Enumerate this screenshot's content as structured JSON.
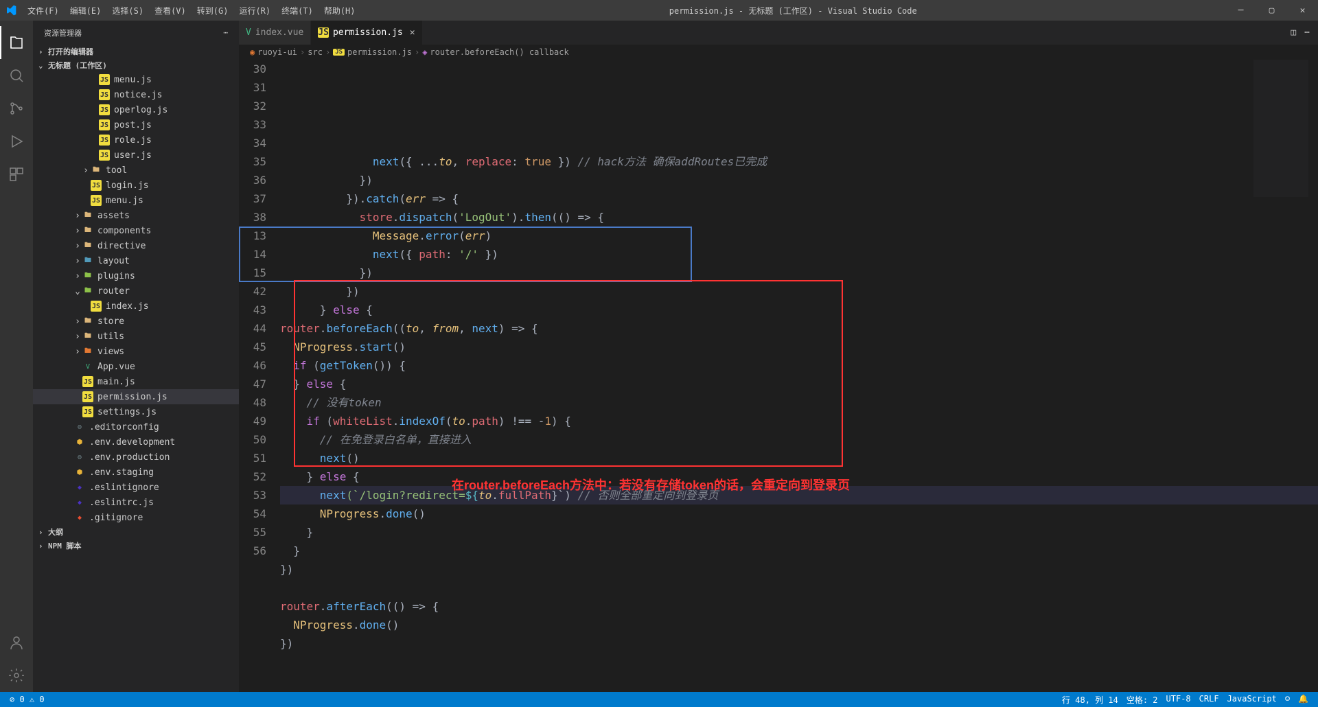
{
  "window": {
    "title": "permission.js - 无标题 (工作区) - Visual Studio Code"
  },
  "menu": {
    "file": "文件(F)",
    "edit": "编辑(E)",
    "select": "选择(S)",
    "view": "查看(V)",
    "goto": "转到(G)",
    "run": "运行(R)",
    "terminal": "终端(T)",
    "help": "帮助(H)"
  },
  "sidebar": {
    "title": "资源管理器",
    "sections": {
      "openEditors": "打开的编辑器",
      "workspace": "无标题 (工作区)",
      "outline": "大纲",
      "npm": "NPM 脚本"
    },
    "tree": {
      "menu_js": "menu.js",
      "notice_js": "notice.js",
      "operlog_js": "operlog.js",
      "post_js": "post.js",
      "role_js": "role.js",
      "user_js": "user.js",
      "tool": "tool",
      "login_js": "login.js",
      "menu_js2": "menu.js",
      "assets": "assets",
      "components": "components",
      "directive": "directive",
      "layout": "layout",
      "plugins": "plugins",
      "router": "router",
      "index_js": "index.js",
      "store": "store",
      "utils": "utils",
      "views": "views",
      "app_vue": "App.vue",
      "main_js": "main.js",
      "permission_js": "permission.js",
      "settings_js": "settings.js",
      "editorconfig": ".editorconfig",
      "env_dev": ".env.development",
      "env_prod": ".env.production",
      "env_staging": ".env.staging",
      "eslintignore": ".eslintignore",
      "eslintrc": ".eslintrc.js",
      "gitignore": ".gitignore"
    }
  },
  "tabs": {
    "index_vue": "index.vue",
    "permission_js": "permission.js"
  },
  "breadcrumbs": {
    "p1": "ruoyi-ui",
    "p2": "src",
    "p3": "permission.js",
    "p4": "router.beforeEach() callback"
  },
  "code": {
    "lines": [
      {
        "n": "30",
        "t": [
          "              ",
          "next",
          "({ ...",
          "to",
          ", ",
          "replace",
          ": ",
          "true",
          " }) ",
          "// hack方法 确保addRoutes已完成"
        ]
      },
      {
        "n": "31",
        "t": [
          "            })"
        ]
      },
      {
        "n": "32",
        "t": [
          "          }).",
          "catch",
          "(",
          "err",
          " => {"
        ]
      },
      {
        "n": "33",
        "t": [
          "            ",
          "store",
          ".",
          "dispatch",
          "(",
          "'LogOut'",
          ").",
          "then",
          "(() => {"
        ]
      },
      {
        "n": "34",
        "t": [
          "              ",
          "Message",
          ".",
          "error",
          "(",
          "err",
          ")"
        ]
      },
      {
        "n": "35",
        "t": [
          "              ",
          "next",
          "({ ",
          "path",
          ": ",
          "'/'",
          " })"
        ]
      },
      {
        "n": "36",
        "t": [
          "            })"
        ]
      },
      {
        "n": "37",
        "t": [
          "          })"
        ]
      },
      {
        "n": "38",
        "t": [
          "      } ",
          "else",
          " {"
        ]
      },
      {
        "n": "13",
        "t": [
          "router",
          ".",
          "beforeEach",
          "((",
          "to",
          ", ",
          "from",
          ", ",
          "next",
          ") => {"
        ]
      },
      {
        "n": "14",
        "t": [
          "  ",
          "NProgress",
          ".",
          "start",
          "()"
        ]
      },
      {
        "n": "15",
        "t": [
          "  ",
          "if",
          " (",
          "getToken",
          "()) {"
        ]
      },
      {
        "n": "42",
        "t": [
          "  } ",
          "else",
          " {"
        ]
      },
      {
        "n": "43",
        "t": [
          "    ",
          "// 没有token"
        ]
      },
      {
        "n": "44",
        "t": [
          "    ",
          "if",
          " (",
          "whiteList",
          ".",
          "indexOf",
          "(",
          "to",
          ".",
          "path",
          ") !== -",
          "1",
          ") {"
        ]
      },
      {
        "n": "45",
        "t": [
          "      ",
          "// 在免登录白名单，直接进入"
        ]
      },
      {
        "n": "46",
        "t": [
          "      ",
          "next",
          "()"
        ]
      },
      {
        "n": "47",
        "t": [
          "    } ",
          "else",
          " {"
        ]
      },
      {
        "n": "48",
        "t": [
          "      ",
          "next",
          "(`/login?redirect=",
          "${",
          "to",
          ".",
          "fullPath",
          "}",
          "`) ",
          "// 否则全部重定向到登录页"
        ]
      },
      {
        "n": "49",
        "t": [
          "      ",
          "NProgress",
          ".",
          "done",
          "()"
        ]
      },
      {
        "n": "50",
        "t": [
          "    }"
        ]
      },
      {
        "n": "51",
        "t": [
          "  }"
        ]
      },
      {
        "n": "52",
        "t": [
          "})"
        ]
      },
      {
        "n": "53",
        "t": [
          ""
        ]
      },
      {
        "n": "54",
        "t": [
          "router",
          ".",
          "afterEach",
          "(() => {"
        ]
      },
      {
        "n": "55",
        "t": [
          "  ",
          "NProgress",
          ".",
          "done",
          "()"
        ]
      },
      {
        "n": "56",
        "t": [
          "})"
        ]
      }
    ]
  },
  "annotation": "在router.beforeEach方法中：若没有存储token的话，会重定向到登录页",
  "statusbar": {
    "errors": "0",
    "warnings": "0",
    "line_col": "行 48, 列 14",
    "spaces": "空格: 2",
    "encoding": "UTF-8",
    "eol": "CRLF",
    "lang": "JavaScript"
  }
}
